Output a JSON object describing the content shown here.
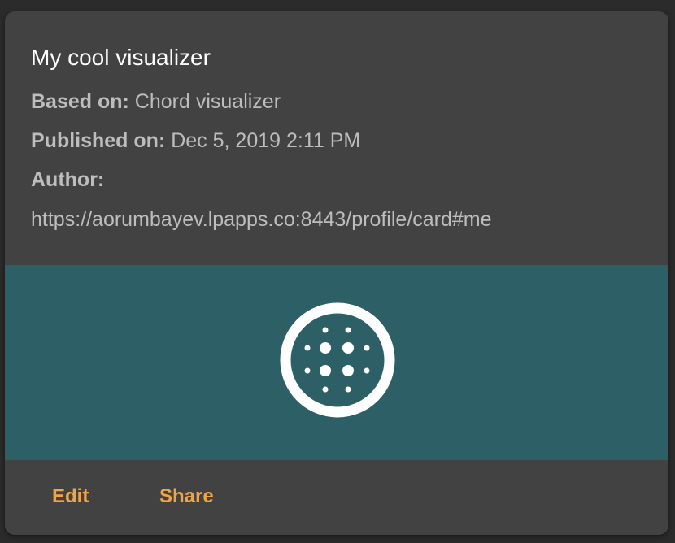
{
  "card": {
    "title": "My cool visualizer",
    "based_on": {
      "label": "Based on:",
      "value": " Chord visualizer"
    },
    "published_on": {
      "label": "Published on:",
      "value": " Dec 5, 2019 2:11 PM"
    },
    "author": {
      "label": "Author:",
      "value": "https://aorumbayev.lpapps.co:8443/profile/card#me"
    },
    "media": {
      "background_color": "#2d6066",
      "icon": "dotted-circle-icon"
    },
    "actions": {
      "edit_label": "Edit",
      "share_label": "Share",
      "accent_color": "#f0a448"
    }
  }
}
